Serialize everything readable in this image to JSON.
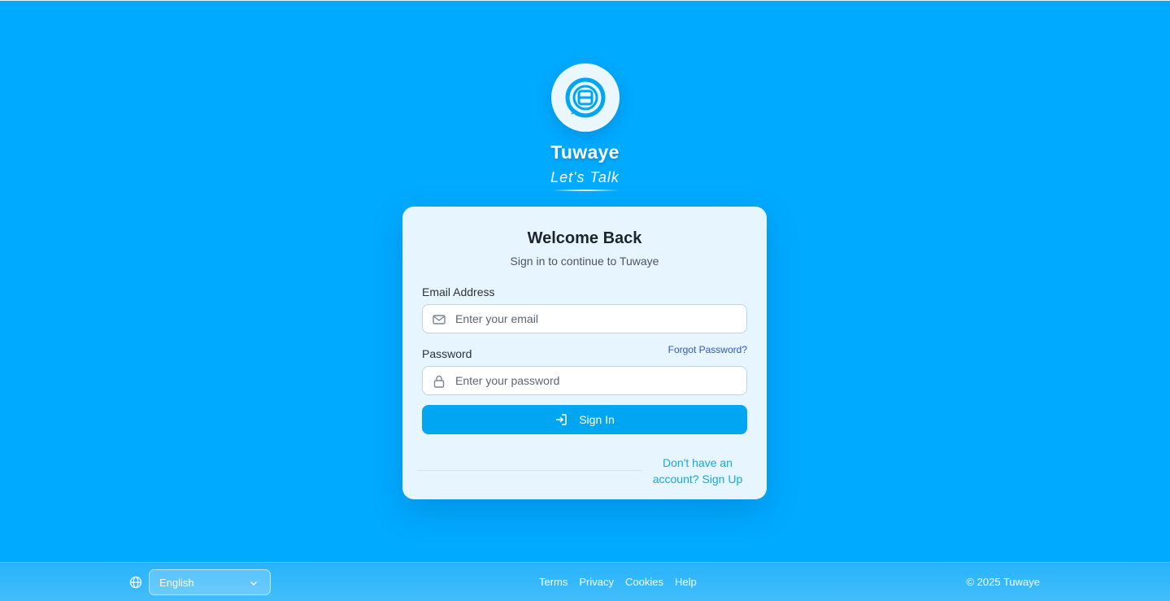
{
  "brand": {
    "name": "Tuwaye",
    "tagline": "Let's Talk",
    "logo_icon": "chat-bubble-logo-icon"
  },
  "login": {
    "title": "Welcome Back",
    "subtitle": "Sign in to continue to Tuwaye",
    "email": {
      "label": "Email Address",
      "placeholder": "Enter your email",
      "value": "",
      "icon": "mail-icon"
    },
    "password": {
      "label": "Password",
      "placeholder": "Enter your password",
      "value": "",
      "icon": "lock-icon"
    },
    "forgot_label": "Forgot Password?",
    "submit_label": "Sign In",
    "submit_icon": "sign-in-icon",
    "signup_line1": "Don't have an",
    "signup_line2": "account? Sign Up"
  },
  "footer": {
    "language_icon": "globe-icon",
    "language": "English",
    "links": [
      "Terms",
      "Privacy",
      "Cookies",
      "Help"
    ],
    "copyright": "© 2025 Tuwaye"
  },
  "colors": {
    "background": "#00aaff",
    "primary_button": "#00a6f2",
    "card": "#e7f6fe",
    "link": "#2f56c9",
    "signup_link": "#14a8e6"
  }
}
